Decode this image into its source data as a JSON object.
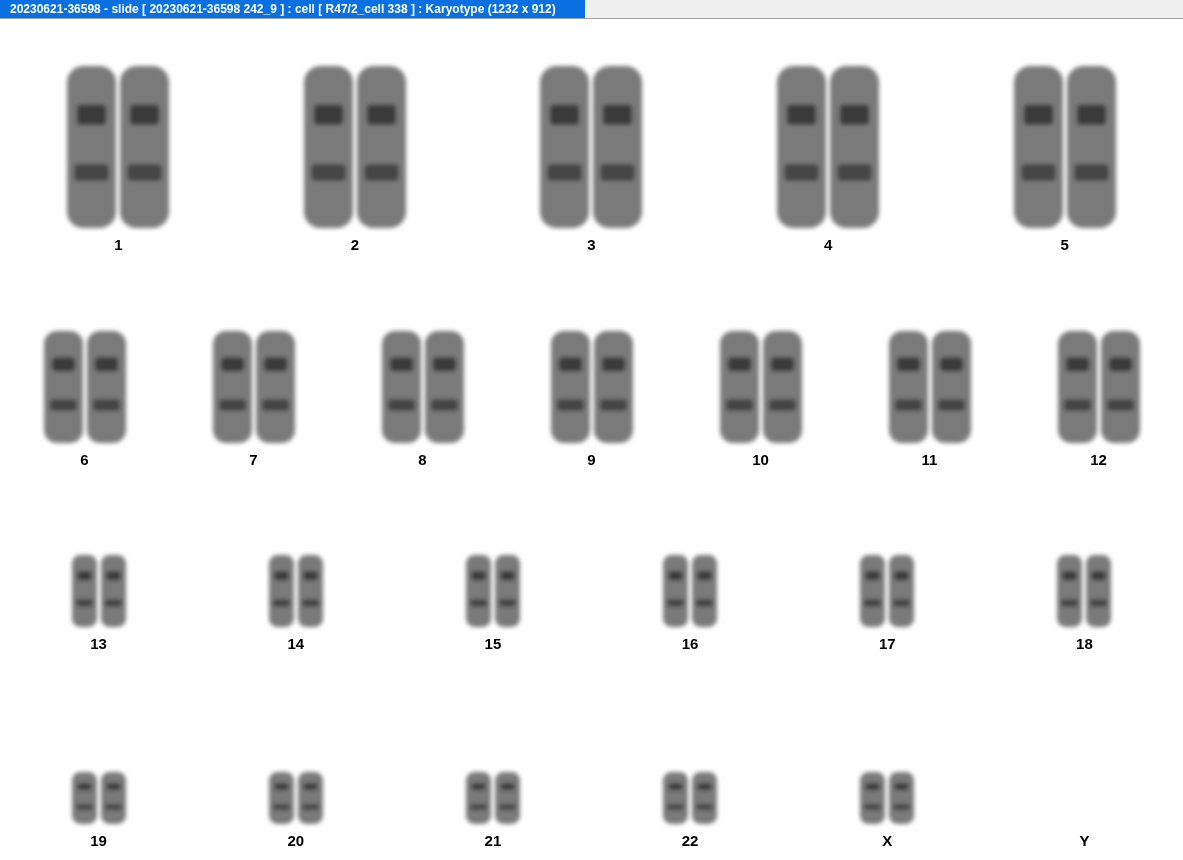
{
  "window": {
    "title": "20230621-36598 - slide [ 20230621-36598 242_9 ] : cell [ R47/2_cell 338 ] : Karyotype  (1232 x 912)"
  },
  "karyotype": {
    "rows": [
      {
        "groups": [
          {
            "label": "1",
            "kind": "pair"
          },
          {
            "label": "2",
            "kind": "pair"
          },
          {
            "label": "3",
            "kind": "pair"
          },
          {
            "label": "4",
            "kind": "pair"
          },
          {
            "label": "5",
            "kind": "pair"
          }
        ]
      },
      {
        "groups": [
          {
            "label": "6",
            "kind": "pair"
          },
          {
            "label": "7",
            "kind": "pair"
          },
          {
            "label": "8",
            "kind": "pair"
          },
          {
            "label": "9",
            "kind": "pair"
          },
          {
            "label": "10",
            "kind": "pair"
          },
          {
            "label": "11",
            "kind": "pair"
          },
          {
            "label": "12",
            "kind": "pair"
          }
        ]
      },
      {
        "groups": [
          {
            "label": "13",
            "kind": "pair"
          },
          {
            "label": "14",
            "kind": "pair"
          },
          {
            "label": "15",
            "kind": "pair"
          },
          {
            "label": "16",
            "kind": "pair"
          },
          {
            "label": "17",
            "kind": "pair"
          },
          {
            "label": "18",
            "kind": "pair"
          }
        ]
      },
      {
        "groups": [
          {
            "label": "19",
            "kind": "pair"
          },
          {
            "label": "20",
            "kind": "pair"
          },
          {
            "label": "21",
            "kind": "pair"
          },
          {
            "label": "22",
            "kind": "pair"
          },
          {
            "label": "X",
            "kind": "pair"
          },
          {
            "label": "Y",
            "kind": "none"
          }
        ]
      }
    ]
  }
}
